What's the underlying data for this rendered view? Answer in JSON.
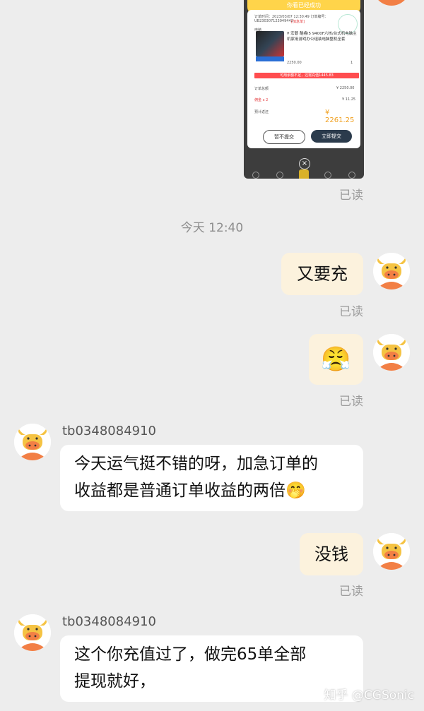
{
  "screenshot_card": {
    "banner_text": "你看已经成功",
    "order_time": "订单时间：2023/03/07 12:30:49 订单编号：",
    "order_no": "UB230307123949442",
    "urgent_tag": "[加急单]",
    "product_tag": "电脑",
    "product_name": "¥ 宏碁 酷睿i5 9400F六核/台式机电脑主机家用游戏办公组装电脑整机全套",
    "price": "2250.00",
    "quantity": "1",
    "warning": "可用余额不足，还需充值1445.83",
    "total_label": "订单总额",
    "total_value": "¥ 2250.00",
    "commission_label": "佣金 x 2",
    "commission_value": "¥ 11.25",
    "expected_label": "预计返还",
    "expected_value": "¥ 2261.25",
    "btn_later": "暂不提交",
    "btn_submit": "立即提交",
    "close_symbol": "×"
  },
  "read_label": "已读",
  "time_separator": "今天 12:40",
  "messages": [
    {
      "side": "right",
      "text": "又要充"
    },
    {
      "side": "right",
      "emoji": "😤"
    },
    {
      "side": "left",
      "username": "tb0348084910",
      "lines": [
        "今天运气挺不错的呀，加急订单的",
        "收益都是普通订单收益的两倍🤭"
      ]
    },
    {
      "side": "right",
      "text": "没钱"
    },
    {
      "side": "left",
      "username": "tb0348084910",
      "lines": [
        "这个你充值过了，做完65单全部",
        "提现就好，"
      ]
    }
  ],
  "watermark": "知乎 @CGSonic",
  "colors": {
    "background": "#ededed",
    "bubble_self": "#fcf2dd",
    "bubble_other": "#ffffff",
    "avatar_orange": "#f27f45",
    "avatar_yellow": "#f5c343",
    "banner_yellow": "#ffd44a"
  }
}
